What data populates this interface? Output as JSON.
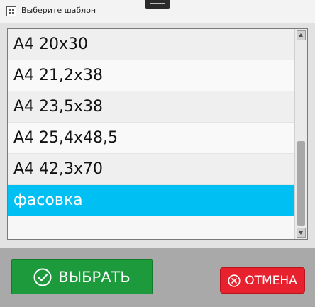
{
  "window": {
    "title": "Выберите шаблон",
    "icon": "grid-app-icon"
  },
  "templates": {
    "items": [
      {
        "label": "А4 20х30",
        "selected": false
      },
      {
        "label": "А4 21,2х38",
        "selected": false
      },
      {
        "label": "А4 23,5х38",
        "selected": false
      },
      {
        "label": "А4 25,4х48,5",
        "selected": false
      },
      {
        "label": "А4 42,3х70",
        "selected": false
      },
      {
        "label": "фасовка",
        "selected": true
      }
    ],
    "selection_color": "#00bff3"
  },
  "actions": {
    "select_label": "ВЫБРАТЬ",
    "select_icon": "check-circle-icon",
    "select_color": "#1d9a3c",
    "cancel_label": "ОТМЕНА",
    "cancel_icon": "x-circle-icon",
    "cancel_color": "#e8212e"
  }
}
